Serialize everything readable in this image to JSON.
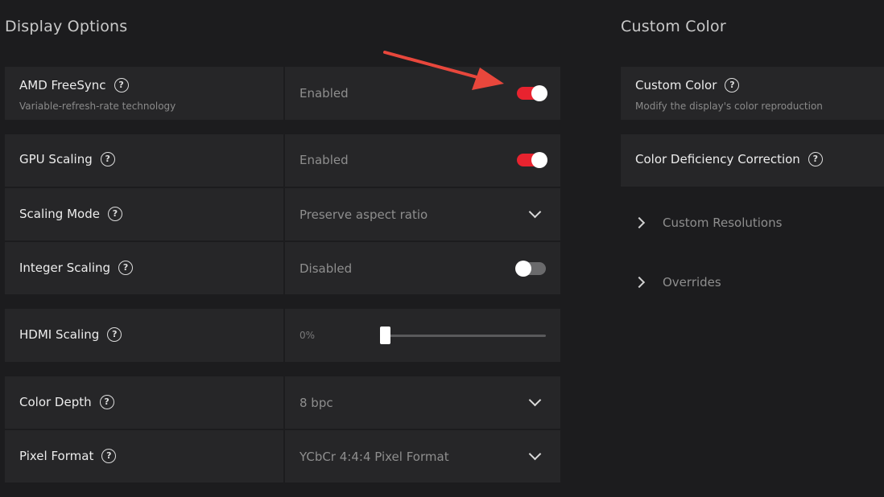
{
  "display_options": {
    "title": "Display Options",
    "rows": [
      {
        "label": "AMD FreeSync",
        "sublabel": "Variable-refresh-rate technology",
        "value": "Enabled",
        "control": "toggle",
        "state": "on"
      },
      {
        "label": "GPU Scaling",
        "value": "Enabled",
        "control": "toggle",
        "state": "on"
      },
      {
        "label": "Scaling Mode",
        "value": "Preserve aspect ratio",
        "control": "dropdown"
      },
      {
        "label": "Integer Scaling",
        "value": "Disabled",
        "control": "toggle",
        "state": "off"
      },
      {
        "label": "HDMI Scaling",
        "value": "0%",
        "control": "slider",
        "level_percent": 0
      },
      {
        "label": "Color Depth",
        "value": "8 bpc",
        "control": "dropdown"
      },
      {
        "label": "Pixel Format",
        "value": "YCbCr 4:4:4 Pixel Format",
        "control": "dropdown"
      }
    ]
  },
  "custom_color": {
    "title": "Custom Color",
    "cards": [
      {
        "label": "Custom Color",
        "sublabel": "Modify the display's color reproduction"
      },
      {
        "label": "Color Deficiency Correction"
      }
    ],
    "expandables": [
      {
        "label": "Custom Resolutions"
      },
      {
        "label": "Overrides"
      }
    ]
  },
  "help_glyph": "?",
  "colors": {
    "background": "#1c1c1e",
    "panel": "#262628",
    "accent_red": "#e8232f",
    "annotation_arrow": "#e8473c"
  },
  "icons": {
    "help": "question-circle-icon",
    "dropdown": "chevron-down-icon",
    "expand": "chevron-right-icon",
    "annotation": "red-arrow-icon"
  }
}
